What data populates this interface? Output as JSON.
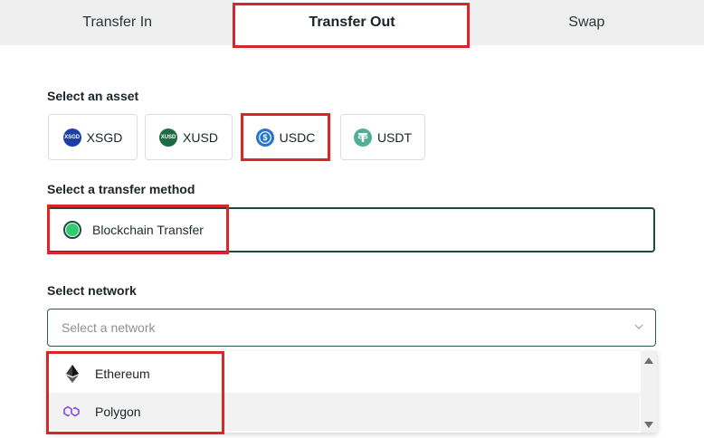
{
  "tabs": [
    {
      "label": "Transfer In"
    },
    {
      "label": "Transfer Out",
      "active": true
    },
    {
      "label": "Swap"
    }
  ],
  "asset_section": {
    "label": "Select an asset",
    "assets": [
      {
        "label": "XSGD",
        "icon": "xsgd-coin-icon",
        "icon_text": "XSGD",
        "color": "#1d3ea8"
      },
      {
        "label": "XUSD",
        "icon": "xusd-coin-icon",
        "icon_text": "XUSD",
        "color": "#1d6b45"
      },
      {
        "label": "USDC",
        "icon": "usdc-coin-icon",
        "color": "#2775ca",
        "selected": true
      },
      {
        "label": "USDT",
        "icon": "usdt-coin-icon",
        "color": "#50af95"
      }
    ]
  },
  "method_section": {
    "label": "Select a transfer method",
    "method": {
      "label": "Blockchain Transfer",
      "selected": true
    }
  },
  "network_section": {
    "label": "Select network",
    "placeholder": "Select a network",
    "options": [
      {
        "label": "Ethereum",
        "icon": "ethereum-icon"
      },
      {
        "label": "Polygon",
        "icon": "polygon-icon",
        "hovered": true
      }
    ]
  },
  "colors": {
    "accent": "#2ecc71",
    "border_dark": "#1f4a40",
    "highlight": "#d9262a"
  }
}
